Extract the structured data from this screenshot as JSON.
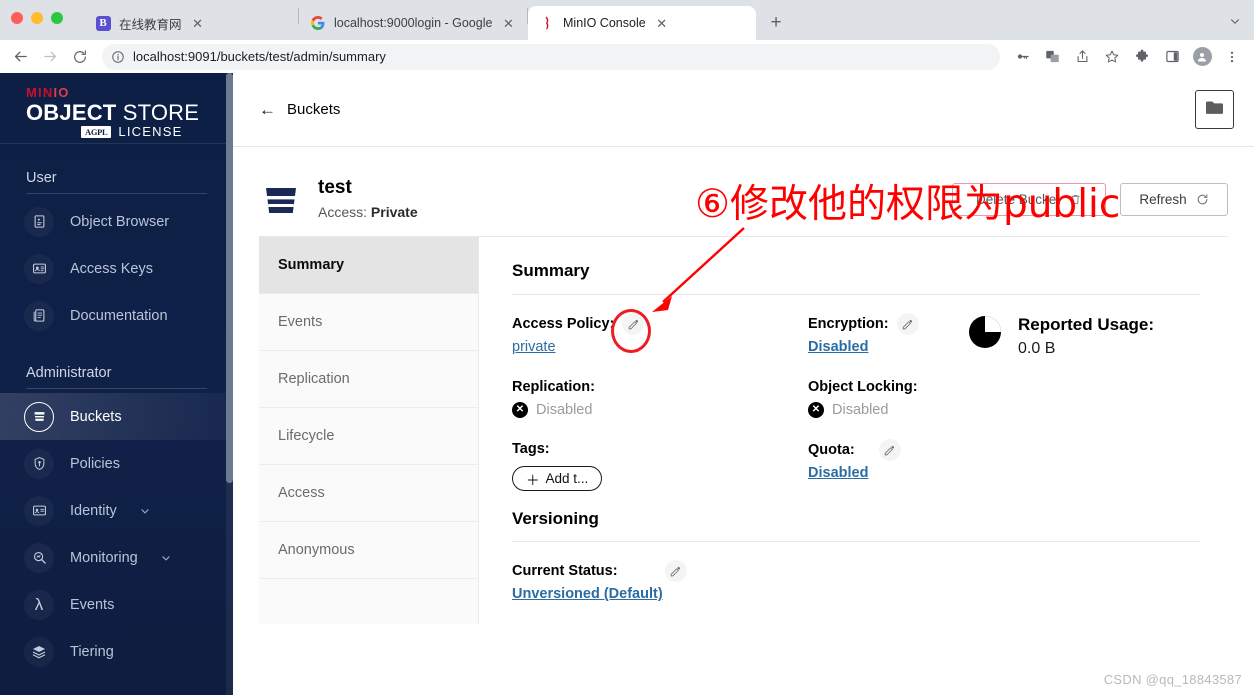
{
  "browser": {
    "tabs": [
      {
        "title": "在线教育网",
        "favicon": "bootstrap-icon",
        "active": false
      },
      {
        "title": "localhost:9000login - Google ",
        "favicon": "google-icon",
        "active": false
      },
      {
        "title": "MinIO Console",
        "favicon": "minio-icon",
        "active": true
      }
    ],
    "new_tab_label": "+",
    "url": "localhost:9091/buckets/test/admin/summary",
    "toolbar_icons": [
      "back-arrow-icon",
      "forward-arrow-icon",
      "reload-icon",
      "info-circle-icon"
    ],
    "omnibox_icons": [
      "password-key-icon",
      "translate-icon",
      "share-icon",
      "bookmark-star-icon"
    ],
    "right_icons": [
      "extensions-puzzle-icon",
      "side-panel-icon",
      "profile-avatar-icon",
      "three-dot-menu-icon"
    ]
  },
  "sidebar": {
    "logo": {
      "mini": "MIN",
      "mini_o": "IO",
      "store_bold": "OBJECT",
      "store_light": "STORE",
      "license_badge": "AGPL",
      "license_word": "LICENSE"
    },
    "groups": [
      {
        "heading": "User",
        "items": [
          {
            "label": "Object Browser",
            "icon": "object-browser-icon",
            "active": false,
            "expandable": false
          },
          {
            "label": "Access Keys",
            "icon": "access-keys-icon",
            "active": false,
            "expandable": false
          },
          {
            "label": "Documentation",
            "icon": "documentation-icon",
            "active": false,
            "expandable": false
          }
        ]
      },
      {
        "heading": "Administrator",
        "items": [
          {
            "label": "Buckets",
            "icon": "buckets-icon",
            "active": true,
            "expandable": false
          },
          {
            "label": "Policies",
            "icon": "policies-icon",
            "active": false,
            "expandable": false
          },
          {
            "label": "Identity",
            "icon": "identity-icon",
            "active": false,
            "expandable": true
          },
          {
            "label": "Monitoring",
            "icon": "monitoring-icon",
            "active": false,
            "expandable": true
          },
          {
            "label": "Events",
            "icon": "events-lambda-icon",
            "active": false,
            "expandable": false
          },
          {
            "label": "Tiering",
            "icon": "tiering-icon",
            "active": false,
            "expandable": false
          }
        ]
      }
    ]
  },
  "page": {
    "back_label": "Buckets",
    "folder_button_icon": "folder-icon"
  },
  "bucket": {
    "name": "test",
    "access_prefix": "Access: ",
    "access_value": "Private",
    "delete_label": "Delete Bucket",
    "delete_icon": "trash-icon",
    "refresh_label": "Refresh",
    "refresh_icon": "refresh-icon"
  },
  "tabs": [
    {
      "label": "Summary",
      "active": true
    },
    {
      "label": "Events",
      "active": false
    },
    {
      "label": "Replication",
      "active": false
    },
    {
      "label": "Lifecycle",
      "active": false
    },
    {
      "label": "Access",
      "active": false
    },
    {
      "label": "Anonymous",
      "active": false
    }
  ],
  "summary": {
    "title": "Summary",
    "access_policy_label": "Access Policy:",
    "access_policy_value": "private",
    "replication_label": "Replication:",
    "replication_value": "Disabled",
    "tags_label": "Tags:",
    "add_tag_label": "Add t...",
    "encryption_label": "Encryption:",
    "encryption_value": "Disabled",
    "object_locking_label": "Object Locking:",
    "object_locking_value": "Disabled",
    "quota_label": "Quota:",
    "quota_value": "Disabled",
    "reported_usage_label": "Reported Usage:",
    "reported_usage_value": "0.0 B"
  },
  "versioning": {
    "title": "Versioning",
    "current_status_label": "Current Status:",
    "current_status_value": "Unversioned (Default)"
  },
  "annotation": {
    "text": "⑥修改他的权限为public",
    "color": "#ff0000"
  },
  "watermark": "CSDN @qq_18843587",
  "colors": {
    "sidebar_bg": "#0d1f44",
    "accent_red": "#c8102e",
    "link_blue": "#2b6ca3",
    "annotation_red": "#ff0000"
  }
}
